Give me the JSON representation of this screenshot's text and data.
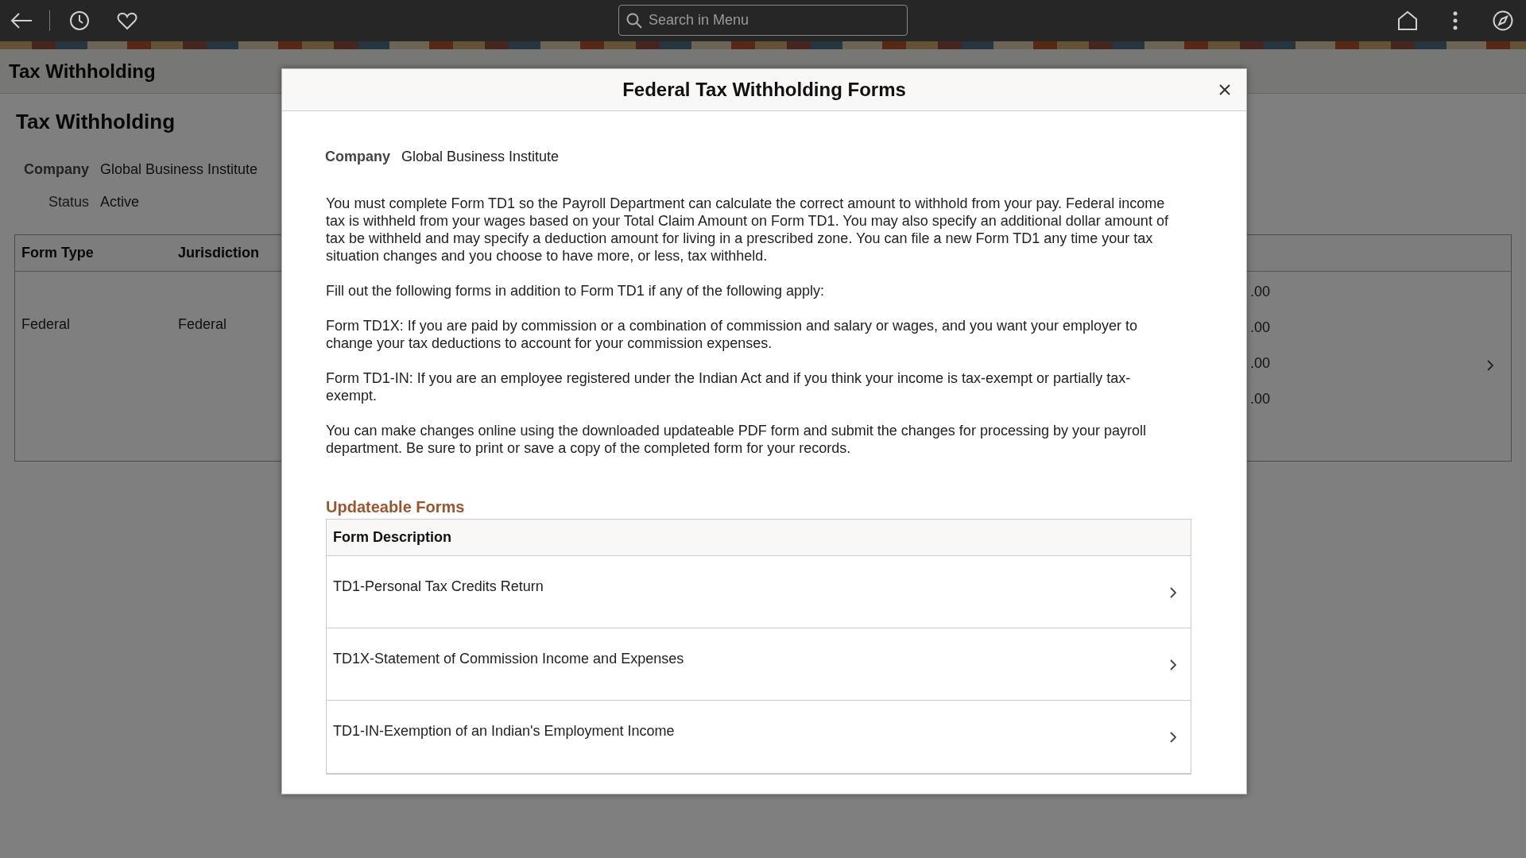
{
  "top_bar": {
    "search": {
      "placeholder": "Search in Menu"
    }
  },
  "page": {
    "header_title": "Tax Withholding",
    "title": "Tax Withholding",
    "fields": [
      {
        "label": "Company",
        "value": "Global Business Institute",
        "emphasized": true
      },
      {
        "label": "Status",
        "value": "Active",
        "emphasized": false
      }
    ],
    "table": {
      "columns": [
        "Form Type",
        "Jurisdiction"
      ],
      "rows": [
        {
          "form_type": "Federal",
          "jurisdiction": "Federal",
          "amounts": [
            ".00",
            ".00",
            ".00",
            ".00"
          ]
        }
      ]
    }
  },
  "modal": {
    "title": "Federal Tax Withholding Forms",
    "company": {
      "label": "Company",
      "value": "Global Business Institute"
    },
    "paragraphs": [
      "You must complete Form TD1 so the Payroll Department can calculate the correct amount to withhold from your pay. Federal income tax is withheld from your wages based on your Total Claim Amount on Form TD1. You may also specify an additional dollar amount of tax be withheld and may specify a deduction amount for living in a prescribed zone. You can file a new Form TD1 any time your tax situation changes and you choose to have more, or less, tax withheld.",
      "Fill out the following forms in addition to Form TD1 if any of the following apply:",
      "Form TD1X: If you are paid by commission or a combination of commission and salary or wages, and you want your employer to change your tax deductions to account for your commission expenses.",
      "Form TD1-IN: If you are an employee registered under the Indian Act and if you think your income is tax-exempt or partially tax-exempt.",
      "You can make changes online using the downloaded updateable PDF form and submit the changes for processing by your payroll department. Be sure to print or save a copy of the completed form for your records."
    ],
    "section_title": "Updateable Forms",
    "table": {
      "columns": [
        "Form Description"
      ],
      "rows": [
        "TD1-Personal Tax Credits Return",
        "TD1X-Statement of Commission Income and Expenses",
        "TD1-IN-Exemption of an Indian's Employment Income"
      ]
    }
  }
}
